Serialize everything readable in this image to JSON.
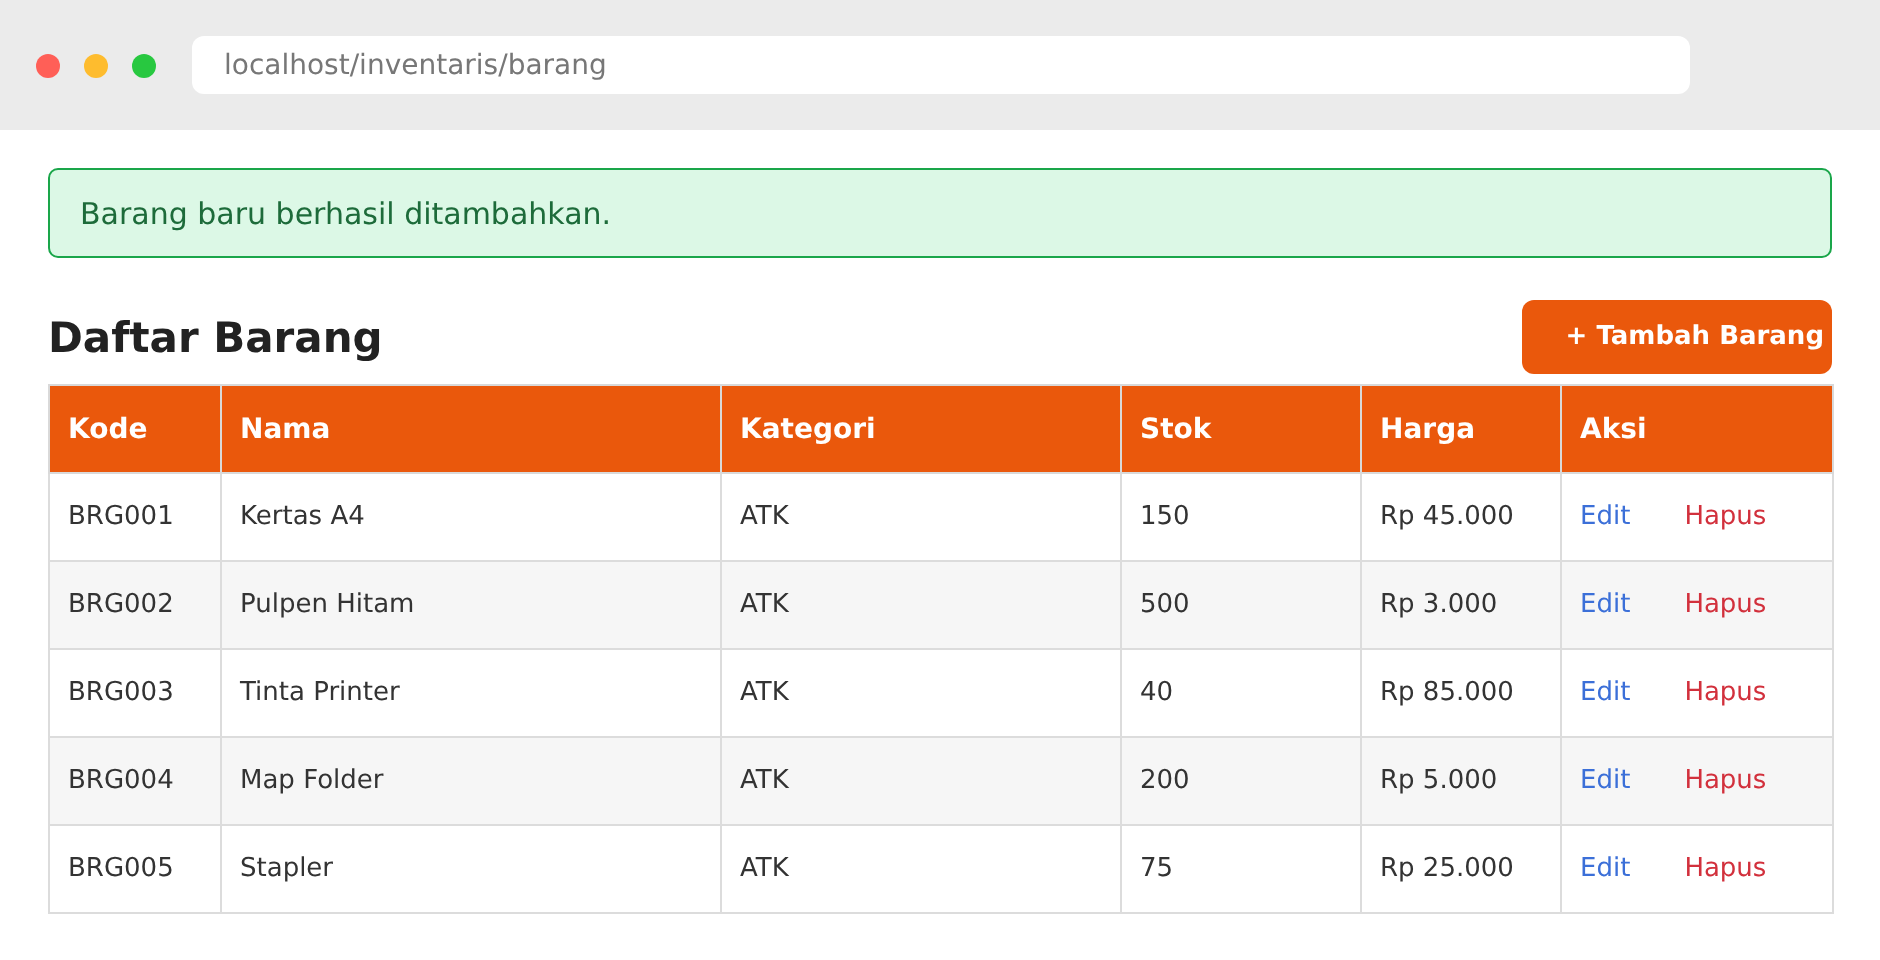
{
  "browser": {
    "url": "localhost/inventaris/barang"
  },
  "alert": {
    "message": "Barang baru berhasil ditambahkan."
  },
  "page": {
    "title": "Daftar Barang",
    "add_button": "+ Tambah Barang"
  },
  "table": {
    "columns": [
      "Kode",
      "Nama",
      "Kategori",
      "Stok",
      "Harga",
      "Aksi"
    ],
    "rows": [
      {
        "kode": "BRG001",
        "nama": "Kertas A4",
        "kategori": "ATK",
        "stok": "150",
        "harga": "Rp 45.000",
        "edit": "Edit",
        "hapus": "Hapus"
      },
      {
        "kode": "BRG002",
        "nama": "Pulpen Hitam",
        "kategori": "ATK",
        "stok": "500",
        "harga": "Rp 3.000",
        "edit": "Edit",
        "hapus": "Hapus"
      },
      {
        "kode": "BRG003",
        "nama": "Tinta Printer",
        "kategori": "ATK",
        "stok": "40",
        "harga": "Rp 85.000",
        "edit": "Edit",
        "hapus": "Hapus"
      },
      {
        "kode": "BRG004",
        "nama": "Map Folder",
        "kategori": "ATK",
        "stok": "200",
        "harga": "Rp 5.000",
        "edit": "Edit",
        "hapus": "Hapus"
      },
      {
        "kode": "BRG005",
        "nama": "Stapler",
        "kategori": "ATK",
        "stok": "75",
        "harga": "Rp 25.000",
        "edit": "Edit",
        "hapus": "Hapus"
      }
    ]
  }
}
